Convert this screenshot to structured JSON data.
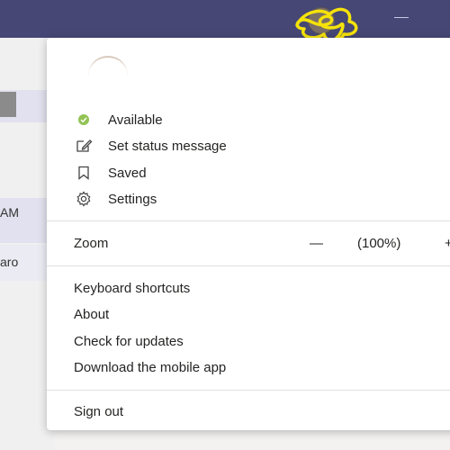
{
  "titlebar": {
    "color": "#464775",
    "icons": [
      "avatar-icon",
      "minimize-icon"
    ]
  },
  "left_pane": {
    "row1_text": "AM",
    "row2_text": "aro"
  },
  "menu": {
    "status": {
      "label": "Available",
      "color": "#92c353"
    },
    "set_status_message": "Set status message",
    "saved": "Saved",
    "settings": "Settings",
    "zoom": {
      "label": "Zoom",
      "minus": "—",
      "value": "(100%)",
      "plus": "+"
    },
    "keyboard_shortcuts": "Keyboard shortcuts",
    "about": "About",
    "check_updates": "Check for updates",
    "download_mobile": "Download the mobile app",
    "sign_out": "Sign out"
  }
}
